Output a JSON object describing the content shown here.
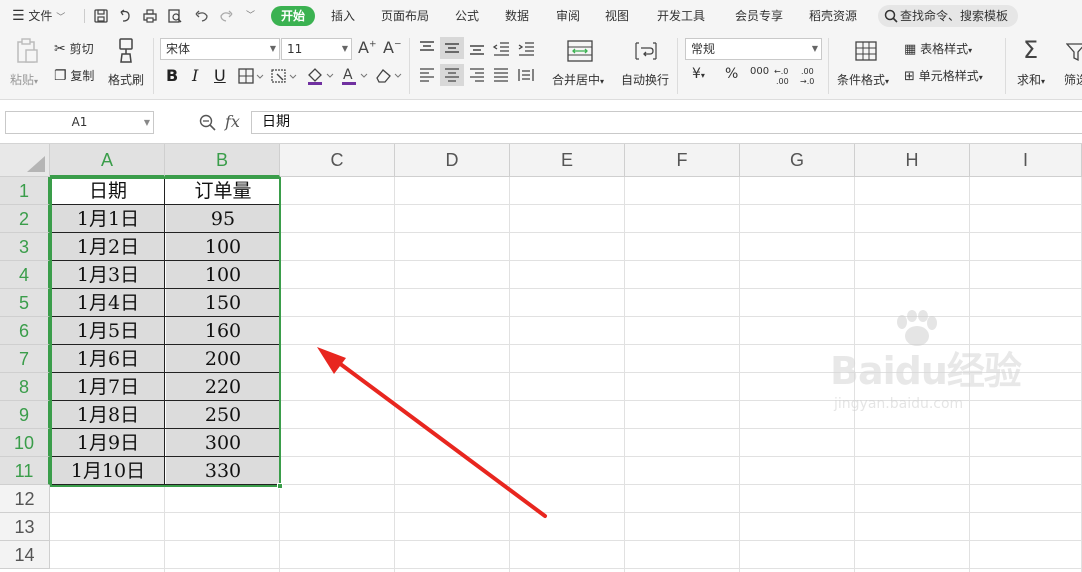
{
  "menubar": {
    "file": "文件",
    "tabs": [
      {
        "label": "开始",
        "active": true
      },
      {
        "label": "插入"
      },
      {
        "label": "页面布局"
      },
      {
        "label": "公式"
      },
      {
        "label": "数据"
      },
      {
        "label": "审阅"
      },
      {
        "label": "视图"
      },
      {
        "label": "开发工具"
      },
      {
        "label": "会员专享"
      },
      {
        "label": "稻壳资源"
      }
    ],
    "search_placeholder": "查找命令、搜索模板"
  },
  "ribbon": {
    "paste": "粘贴",
    "cut": "剪切",
    "copy": "复制",
    "format_painter": "格式刷",
    "font_name": "宋体",
    "font_size": "11",
    "number_format": "常规",
    "merge_center": "合并居中",
    "wrap_text": "自动换行",
    "conditional_format": "条件格式",
    "table_style": "表格样式",
    "cell_style": "单元格样式",
    "sum": "求和",
    "filter": "筛选",
    "bold": "B",
    "italic": "I",
    "underline": "U",
    "currency": "¥",
    "percent": "%",
    "thousands": "000",
    "inc_decimal": "+.0\n.00",
    "dec_decimal": ".00\n→.0"
  },
  "formula_bar": {
    "cell_ref": "A1",
    "fx": "fx",
    "content": "日期"
  },
  "columns": [
    "A",
    "B",
    "C",
    "D",
    "E",
    "F",
    "G",
    "H",
    "I"
  ],
  "rows": [
    "1",
    "2",
    "3",
    "4",
    "5",
    "6",
    "7",
    "8",
    "9",
    "10",
    "11",
    "12",
    "13",
    "14"
  ],
  "table": {
    "headers": [
      "日期",
      "订单量"
    ],
    "rows": [
      [
        "1月1日",
        "95"
      ],
      [
        "1月2日",
        "100"
      ],
      [
        "1月3日",
        "100"
      ],
      [
        "1月4日",
        "150"
      ],
      [
        "1月5日",
        "160"
      ],
      [
        "1月6日",
        "200"
      ],
      [
        "1月7日",
        "220"
      ],
      [
        "1月8日",
        "250"
      ],
      [
        "1月9日",
        "300"
      ],
      [
        "1月10日",
        "330"
      ]
    ]
  },
  "annotation": {
    "arrow_color": "#e8261f"
  },
  "colors": {
    "accent": "#3bb251",
    "selection_border": "#3a9d4a",
    "arrow": "#e8261f"
  },
  "watermark": {
    "brand": "Baidu经验",
    "url": "jingyan.baidu.com"
  }
}
